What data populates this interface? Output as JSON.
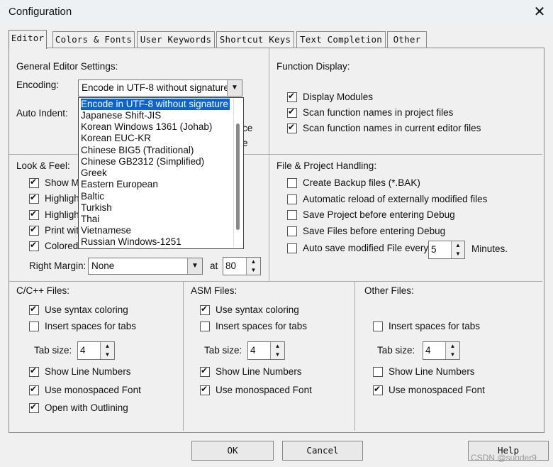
{
  "window": {
    "title": "Configuration",
    "close_glyph": "✕"
  },
  "tabs": [
    {
      "label": "Editor"
    },
    {
      "label": "Colors & Fonts"
    },
    {
      "label": "User Keywords"
    },
    {
      "label": "Shortcut Keys"
    },
    {
      "label": "Text Completion"
    },
    {
      "label": "Other"
    }
  ],
  "general": {
    "heading": "General Editor Settings:",
    "encoding_label": "Encoding:",
    "encoding_value": "Encode in UTF-8 without signature",
    "auto_indent_label": "Auto Indent:",
    "hidden_text_1": "ce",
    "hidden_text_2": "e",
    "encoding_options": [
      "Encode in UTF-8 without signature",
      "Japanese Shift-JIS",
      "Korean Windows 1361 (Johab)",
      "Korean EUC-KR",
      "Chinese BIG5 (Traditional)",
      "Chinese GB2312 (Simplified)",
      "Greek",
      "Eastern European",
      "Baltic",
      "Turkish",
      "Thai",
      "Vietnamese",
      "Russian Windows-1251"
    ]
  },
  "function_display": {
    "heading": "Function Display:",
    "options": [
      {
        "label": "Display Modules",
        "checked": true
      },
      {
        "label": "Scan function names in project files",
        "checked": true
      },
      {
        "label": "Scan function names in current editor files",
        "checked": true
      }
    ]
  },
  "look_feel": {
    "heading": "Look & Feel:",
    "visible_fragments": [
      "Show M",
      "Highligh",
      "Highligh",
      "Print wit",
      "Colored"
    ],
    "right_margin_label": "Right Margin:",
    "right_margin_value": "None",
    "at_label": "at",
    "at_value": "80"
  },
  "file_project": {
    "heading": "File & Project Handling:",
    "options": [
      {
        "label": "Create Backup files (*.BAK)",
        "checked": false
      },
      {
        "label": "Automatic reload of externally modified files",
        "checked": false
      },
      {
        "label": "Save Project before entering Debug",
        "checked": false
      },
      {
        "label": "Save Files before entering Debug",
        "checked": false
      }
    ],
    "autosave_label": "Auto save modified File every",
    "autosave_value": "5",
    "autosave_unit": "Minutes."
  },
  "cpp_files": {
    "heading": "C/C++ Files:",
    "use_syntax_coloring": "Use syntax coloring",
    "insert_spaces": "Insert spaces for tabs",
    "tab_size_label": "Tab size:",
    "tab_size": "4",
    "show_line_numbers": "Show Line Numbers",
    "monospaced_font": "Use monospaced Font",
    "open_outlining": "Open with Outlining"
  },
  "asm_files": {
    "heading": "ASM Files:",
    "use_syntax_coloring": "Use syntax coloring",
    "insert_spaces": "Insert spaces for tabs",
    "tab_size_label": "Tab size:",
    "tab_size": "4",
    "show_line_numbers": "Show Line Numbers",
    "monospaced_font": "Use monospaced Font"
  },
  "other_files": {
    "heading": "Other Files:",
    "insert_spaces": "Insert spaces for tabs",
    "tab_size_label": "Tab size:",
    "tab_size": "4",
    "show_line_numbers": "Show Line Numbers",
    "monospaced_font": "Use monospaced Font"
  },
  "buttons": {
    "ok": "OK",
    "cancel": "Cancel",
    "help": "Help"
  },
  "watermark": "CSDN @sunder9",
  "colors": {
    "selection": "#0a64d4",
    "dialog_bg": "#f0f0f0"
  }
}
